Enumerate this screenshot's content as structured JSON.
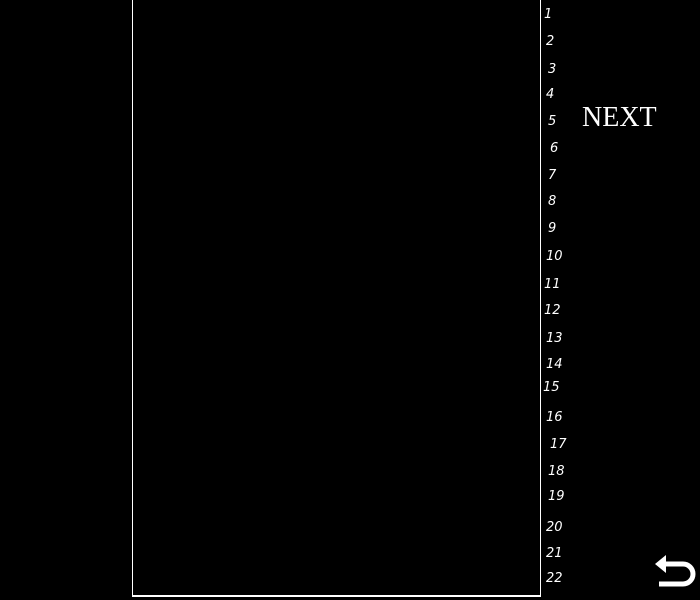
{
  "panel": {
    "next_label": "NEXT"
  },
  "row_numbers": [
    "1",
    "2",
    "3",
    "4",
    "5",
    "6",
    "7",
    "8",
    "9",
    "10",
    "11",
    "12",
    "13",
    "14",
    "15",
    "16",
    "17",
    "18",
    "19",
    "20",
    "21",
    "22"
  ],
  "controls": {
    "back_icon": "undo-arrow-icon"
  },
  "colors": {
    "background": "#000000",
    "foreground": "#ffffff"
  }
}
